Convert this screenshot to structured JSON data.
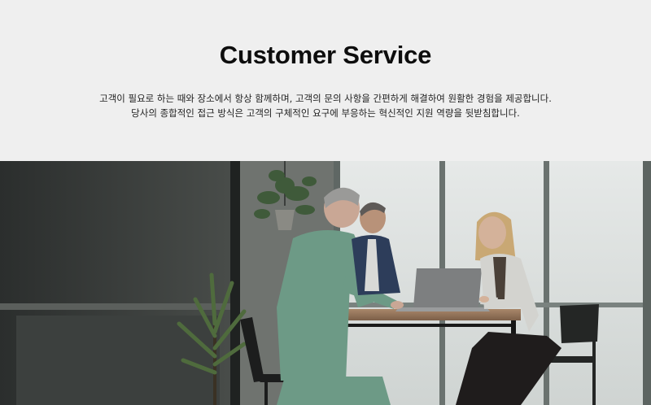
{
  "hero": {
    "title": "Customer Service",
    "description_line1": "고객이 필요로 하는 때와 장소에서 항상 함께하며, 고객의 문의 사항을 간편하게 해결하여 원활한 경험을 제공합니다.",
    "description_line2": "당사의 종합적인 접근 방식은 고객의 구체적인 요구에 부응하는 혁신적인 지원 역량을 뒷받침합니다."
  },
  "colors": {
    "page_background": "#efefef",
    "title_text": "#0d0d0d",
    "body_text": "#222222"
  }
}
